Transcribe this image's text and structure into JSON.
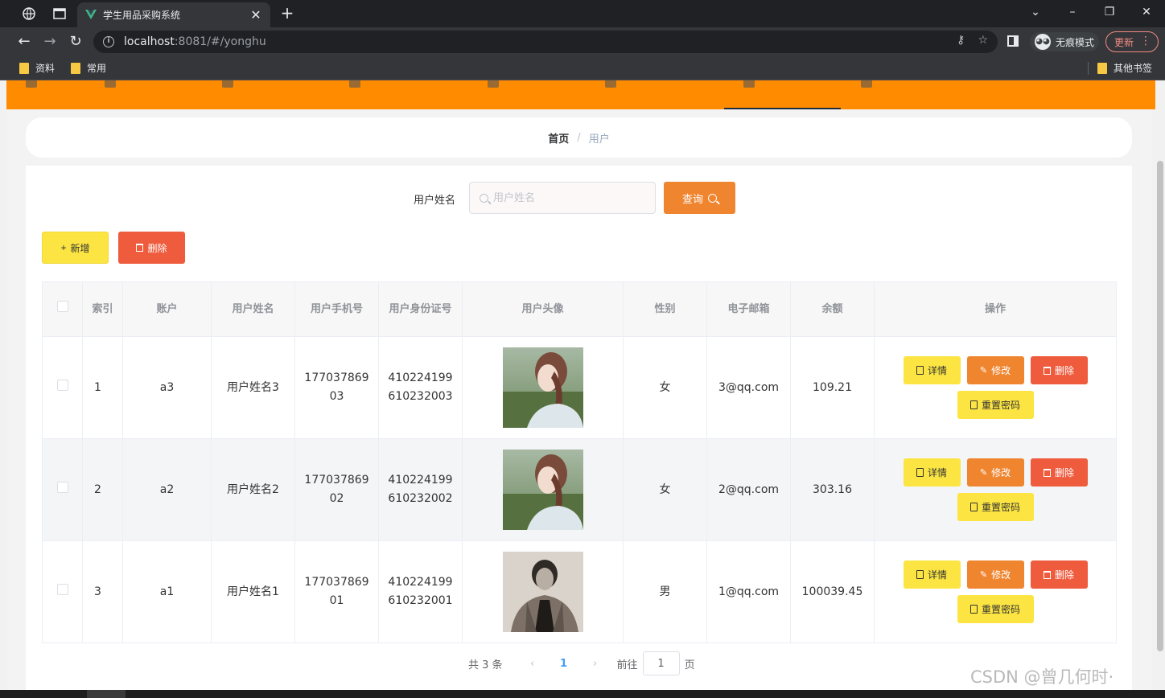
{
  "browser": {
    "tab_title": "学生用品采购系统",
    "url_host": "localhost",
    "url_rest": ":8081/#/yonghu",
    "incognito_label": "无痕模式",
    "update_label": "更新",
    "bookmarks": [
      "资料",
      "常用"
    ],
    "other_bookmarks": "其他书签"
  },
  "breadcrumb": {
    "home": "首页",
    "separator": "/",
    "current": "用户"
  },
  "search": {
    "label": "用户姓名",
    "placeholder": "用户姓名",
    "button": "查询"
  },
  "actions": {
    "add": "新增",
    "delete": "删除"
  },
  "table": {
    "headers": [
      "索引",
      "账户",
      "用户姓名",
      "用户手机号",
      "用户身份证号",
      "用户头像",
      "性别",
      "电子邮箱",
      "余额",
      "操作"
    ],
    "rows": [
      {
        "index": "1",
        "account": "a3",
        "name": "用户姓名3",
        "phone": "17703786903",
        "id_card": "410224199610232003",
        "gender": "女",
        "email": "3@qq.com",
        "balance": "109.21",
        "avatar": "girl-photo"
      },
      {
        "index": "2",
        "account": "a2",
        "name": "用户姓名2",
        "phone": "17703786902",
        "id_card": "410224199610232002",
        "gender": "女",
        "email": "2@qq.com",
        "balance": "303.16",
        "avatar": "girl-photo"
      },
      {
        "index": "3",
        "account": "a1",
        "name": "用户姓名1",
        "phone": "17703786901",
        "id_card": "410224199610232001",
        "gender": "男",
        "email": "1@qq.com",
        "balance": "100039.45",
        "avatar": "man-photo"
      }
    ],
    "row_actions": {
      "detail": "详情",
      "edit": "修改",
      "delete": "删除",
      "reset": "重置密码"
    }
  },
  "pagination": {
    "total": "共 3 条",
    "current_page": "1",
    "goto_prefix": "前往",
    "goto_value": "1",
    "goto_suffix": "页"
  },
  "watermark": "CSDN @曾几何时·",
  "colors": {
    "nav_bg": "#ff8c00",
    "query": "#f08530",
    "add": "#fce542",
    "delete": "#ee5b3d"
  }
}
